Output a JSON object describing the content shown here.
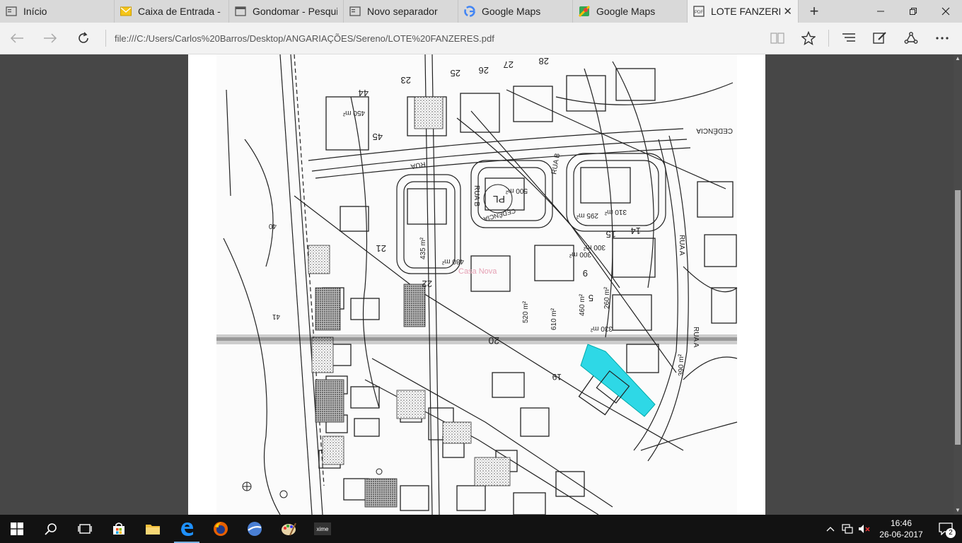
{
  "tabs": [
    {
      "label": "Início",
      "icon": "tab-page-icon",
      "active": false
    },
    {
      "label": "Caixa de Entrada - ch",
      "icon": "mail-icon",
      "active": false
    },
    {
      "label": "Gondomar - Pesquisa",
      "icon": "page-icon",
      "active": false
    },
    {
      "label": "Novo separador",
      "icon": "tab-page-icon",
      "active": false
    },
    {
      "label": "Google Maps",
      "icon": "google-icon",
      "active": false
    },
    {
      "label": "Google Maps",
      "icon": "maps-icon",
      "active": false
    },
    {
      "label": "LOTE FANZERES.p",
      "icon": "pdf-icon",
      "active": true
    }
  ],
  "address": {
    "url": "file:///C:/Users/Carlos%20Barros/Desktop/ANGARIAÇÕES/Sereno/LOTE%20FANZERES.pdf"
  },
  "map": {
    "labels": [
      "450 m²",
      "44",
      "45",
      "RUA",
      "RUA B",
      "RUA B",
      "500 m²",
      "PL",
      "CEDÊNCIA",
      "RUA A",
      "15",
      "14",
      "9",
      "5",
      "20",
      "19",
      "330 m²",
      "390 m²",
      "300 m²",
      "CEDÊNCIA",
      "260 m²",
      "295 m²",
      "310 m²",
      "480 m²",
      "435 m²",
      "610 m²",
      "520 m²",
      "460 m²",
      "300 m²",
      "26",
      "27",
      "28",
      "25",
      "23",
      "22",
      "21",
      "41",
      "40",
      "RUA A"
    ],
    "watermark": "Casa Nova"
  },
  "taskbar": {
    "time": "16:46",
    "date": "26-06-2017",
    "notifications": "2"
  },
  "colors": {
    "highlight": "#2ed8e6",
    "tabbar": "#d9d9d9",
    "taskbar": "#121212"
  }
}
